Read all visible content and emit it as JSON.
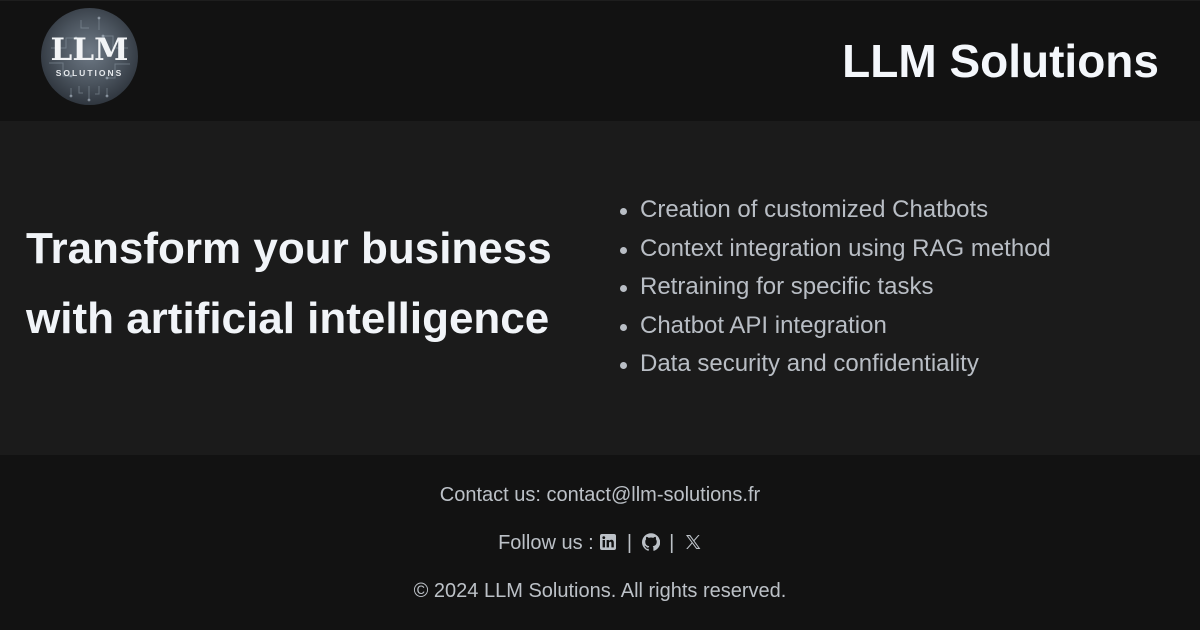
{
  "header": {
    "logo": {
      "main": "LLM",
      "sub": "SOLUTIONS"
    },
    "site_title": "LLM Solutions"
  },
  "hero": {
    "headline_line1": "Transform your business",
    "headline_line2": "with artificial intelligence",
    "features": [
      "Creation of customized Chatbots",
      "Context integration using RAG method",
      "Retraining for specific tasks",
      "Chatbot API integration",
      "Data security and confidentiality"
    ]
  },
  "footer": {
    "contact_label": "Contact us: ",
    "contact_email": "contact@llm-solutions.fr",
    "follow_label": "Follow us : ",
    "separator": "|",
    "social_icons": [
      "linkedin-icon",
      "github-icon",
      "x-icon"
    ],
    "copyright": "© 2024 LLM Solutions. All rights reserved."
  },
  "colors": {
    "page_background": "#121212",
    "main_background": "#1b1b1b",
    "heading_text": "#f1f4f8",
    "body_text": "#b9bec5"
  }
}
